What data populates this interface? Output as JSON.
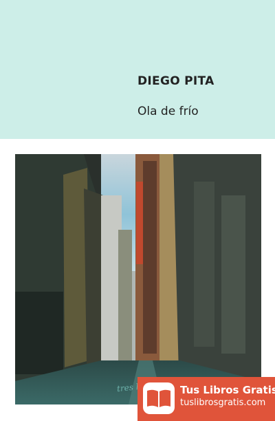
{
  "book": {
    "author": "DIEGO PITA",
    "title": "Ola de frío",
    "publisher_mark": "tres ho"
  },
  "badge": {
    "name": "Tus Libros Gratis",
    "url": "tuslibrosgratis.com",
    "icon": "open-book-icon"
  },
  "colors": {
    "header_bg": "#cdeee8",
    "badge_bg": "#e0543a"
  }
}
